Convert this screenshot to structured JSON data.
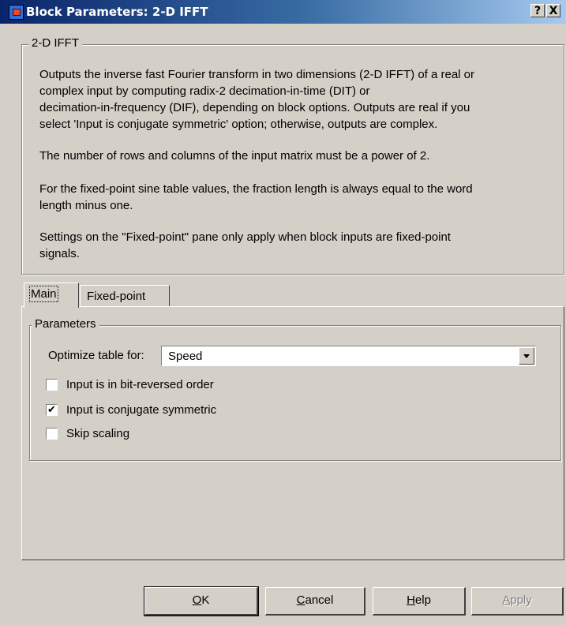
{
  "window": {
    "title": "Block Parameters: 2-D IFFT",
    "help_button": "?",
    "close_button": "X"
  },
  "description": {
    "group_title": "2-D IFFT",
    "lines": [
      "Outputs the inverse fast Fourier transform in two dimensions (2-D IFFT) of a real or",
      "complex input by computing radix-2 decimation-in-time (DIT) or",
      "decimation-in-frequency (DIF), depending on block options. Outputs are real if you",
      "select 'Input is conjugate symmetric' option; otherwise, outputs are complex.",
      "The number of rows and columns of the input matrix must be a power of 2.",
      "For the fixed-point sine table values, the fraction length is always equal to the word",
      "length minus one.",
      "Settings on the \"Fixed-point\" pane only apply when block inputs are fixed-point",
      "signals."
    ]
  },
  "tabs": [
    {
      "label": "Main",
      "active": true
    },
    {
      "label": "Fixed-point",
      "active": false
    }
  ],
  "parameters": {
    "group_title": "Parameters",
    "optimize_label": "Optimize table for:",
    "optimize_value": "Speed",
    "checkboxes": [
      {
        "label": "Input is in bit-reversed order",
        "checked": false
      },
      {
        "label": "Input is conjugate symmetric",
        "checked": true
      },
      {
        "label": "Skip scaling",
        "checked": false
      }
    ]
  },
  "buttons": {
    "ok": {
      "mnemonic": "O",
      "rest": "K"
    },
    "cancel": {
      "mnemonic": "C",
      "rest": "ancel"
    },
    "help": {
      "mnemonic": "H",
      "rest": "elp"
    },
    "apply": {
      "mnemonic": "A",
      "rest": "pply",
      "disabled": true
    }
  },
  "colors": {
    "face": "#d4d0c8",
    "title_start": "#0a246a",
    "title_end": "#a6caf0"
  }
}
